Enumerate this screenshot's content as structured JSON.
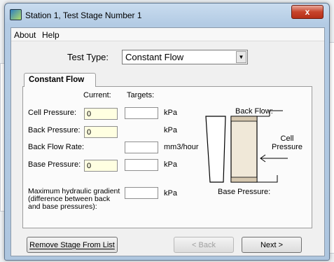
{
  "window": {
    "title": "Station 1, Test Stage Number 1",
    "close_glyph": "x"
  },
  "menu": {
    "items": [
      "About",
      "Help"
    ]
  },
  "test_type": {
    "label": "Test Type:",
    "value": "Constant Flow"
  },
  "tab": {
    "label": "Constant Flow"
  },
  "columns": {
    "current": "Current:",
    "targets": "Targets:"
  },
  "rows": [
    {
      "label": "Cell Pressure:",
      "current": "0",
      "unit": "kPa"
    },
    {
      "label": "Back Pressure:",
      "current": "0",
      "unit": "kPa"
    },
    {
      "label": "Back Flow Rate:",
      "unit": "mm3/hour"
    },
    {
      "label": "Base Pressure:",
      "current": "0",
      "unit": "kPa"
    }
  ],
  "gradient": {
    "label_lines": [
      "Maximum hydraulic gradient",
      "(difference between back",
      "and base pressures):"
    ],
    "unit": "kPa"
  },
  "diagram": {
    "back_flow": "Back Flow:",
    "cell_pressure_lines": [
      "Cell",
      "Pressure"
    ],
    "base_pressure": "Base Pressure:"
  },
  "buttons": {
    "remove": "Remove Stage From List",
    "back": "< Back",
    "next": "Next >"
  },
  "colors": {
    "current_field_bg": "#ffffe1",
    "close_button": "#c7432b"
  }
}
